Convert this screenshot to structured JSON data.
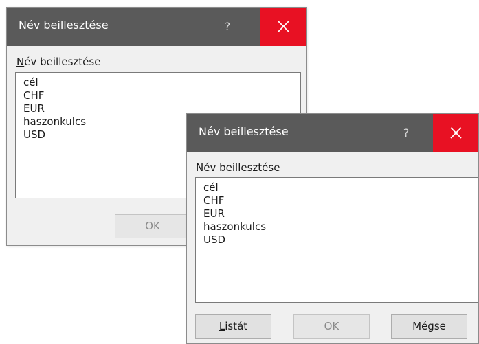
{
  "dialog_back": {
    "title": "Név beillesztése",
    "help": "?",
    "list_label_first": "N",
    "list_label_rest": "év beillesztése",
    "items": [
      "cél",
      "CHF",
      "EUR",
      "haszonkulcs",
      "USD"
    ],
    "ok_label": "OK"
  },
  "dialog_front": {
    "title": "Név beillesztése",
    "help": "?",
    "list_label_first": "N",
    "list_label_rest": "év beillesztése",
    "items": [
      "cél",
      "CHF",
      "EUR",
      "haszonkulcs",
      "USD"
    ],
    "list_button_first": "L",
    "list_button_rest": "istát",
    "ok_label": "OK",
    "cancel_label": "Mégse"
  },
  "colors": {
    "titlebar": "#5a5a5a",
    "close_red": "#e81123",
    "dialog_bg": "#f0f0f0"
  },
  "icons": [
    "close-icon",
    "help-icon"
  ]
}
